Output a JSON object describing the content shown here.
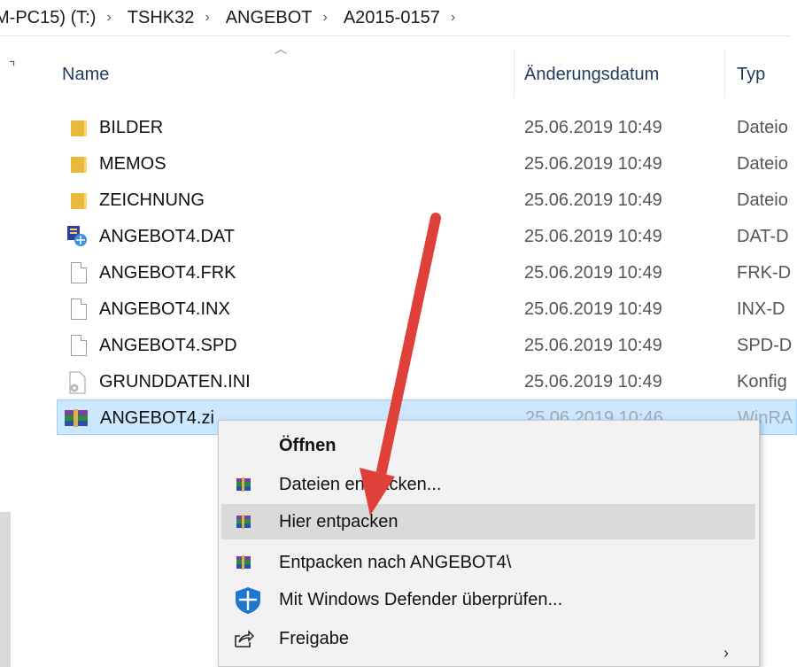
{
  "breadcrumb": {
    "items": [
      "M-PC15) (T:)",
      "TSHK32",
      "ANGEBOT",
      "A2015-0157"
    ],
    "separator": "›"
  },
  "columns": {
    "name": "Name",
    "date": "Änderungsdatum",
    "type": "Typ"
  },
  "files": [
    {
      "name": "BILDER",
      "date": "25.06.2019 10:49",
      "type": "Dateio",
      "icon": "folder-icon"
    },
    {
      "name": "MEMOS",
      "date": "25.06.2019 10:49",
      "type": "Dateio",
      "icon": "folder-icon"
    },
    {
      "name": "ZEICHNUNG",
      "date": "25.06.2019 10:49",
      "type": "Dateio",
      "icon": "folder-icon"
    },
    {
      "name": "ANGEBOT4.DAT",
      "date": "25.06.2019 10:49",
      "type": "DAT-D",
      "icon": "dat-file-icon"
    },
    {
      "name": "ANGEBOT4.FRK",
      "date": "25.06.2019 10:49",
      "type": "FRK-D",
      "icon": "file-icon"
    },
    {
      "name": "ANGEBOT4.INX",
      "date": "25.06.2019 10:49",
      "type": "INX-D",
      "icon": "file-icon"
    },
    {
      "name": "ANGEBOT4.SPD",
      "date": "25.06.2019 10:49",
      "type": "SPD-D",
      "icon": "file-icon"
    },
    {
      "name": "GRUNDDATEN.INI",
      "date": "25.06.2019 10:49",
      "type": "Konfig",
      "icon": "settings-file-icon"
    },
    {
      "name": "ANGEBOT4.zi",
      "date": "25.06.2019 10:46",
      "type": "WinRA",
      "icon": "winrar-archive-icon"
    }
  ],
  "context_menu": {
    "items": [
      {
        "label": "Öffnen",
        "icon": "",
        "bold": true
      },
      {
        "label": "Dateien entpacken...",
        "icon": "winrar-icon"
      },
      {
        "label": "Hier entpacken",
        "icon": "winrar-icon",
        "highlighted": true
      },
      {
        "label": "Entpacken nach ANGEBOT4\\",
        "icon": "winrar-icon"
      },
      {
        "label": "Mit Windows Defender überprüfen...",
        "icon": "windows-defender-icon"
      },
      {
        "label": "Freigabe",
        "icon": "share-icon"
      }
    ]
  },
  "colors": {
    "selection_bg": "#cce8ff",
    "menu_bg": "#f2f2f2",
    "menu_hover": "#dadada",
    "annotation_arrow": "#e0403a"
  }
}
